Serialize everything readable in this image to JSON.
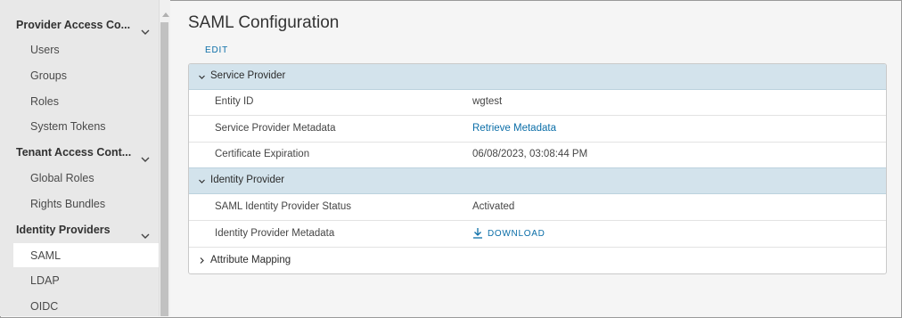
{
  "sidebar": {
    "sections": [
      {
        "title": "Provider Access Co...",
        "items": [
          "Users",
          "Groups",
          "Roles",
          "System Tokens"
        ]
      },
      {
        "title": "Tenant Access Cont...",
        "items": [
          "Global Roles",
          "Rights Bundles"
        ]
      },
      {
        "title": "Identity Providers",
        "items": [
          "SAML",
          "LDAP",
          "OIDC"
        ]
      }
    ],
    "active_item": "SAML"
  },
  "main": {
    "title": "SAML Configuration",
    "edit_label": "EDIT",
    "service_provider": {
      "title": "Service Provider",
      "rows": [
        {
          "key": "Entity ID",
          "value": "wgtest"
        },
        {
          "key": "Service Provider Metadata",
          "value": "Retrieve Metadata"
        },
        {
          "key": "Certificate Expiration",
          "value": "06/08/2023, 03:08:44 PM"
        }
      ]
    },
    "identity_provider": {
      "title": "Identity Provider",
      "rows": [
        {
          "key": "SAML Identity Provider Status",
          "value": "Activated"
        },
        {
          "key": "Identity Provider Metadata",
          "value": "DOWNLOAD"
        }
      ]
    },
    "attribute_mapping": {
      "title": "Attribute Mapping"
    }
  },
  "colors": {
    "accent_link": "#0b6ea8",
    "group_header_bg": "#d3e3ec",
    "sidebar_bg": "#e8e8e8"
  }
}
